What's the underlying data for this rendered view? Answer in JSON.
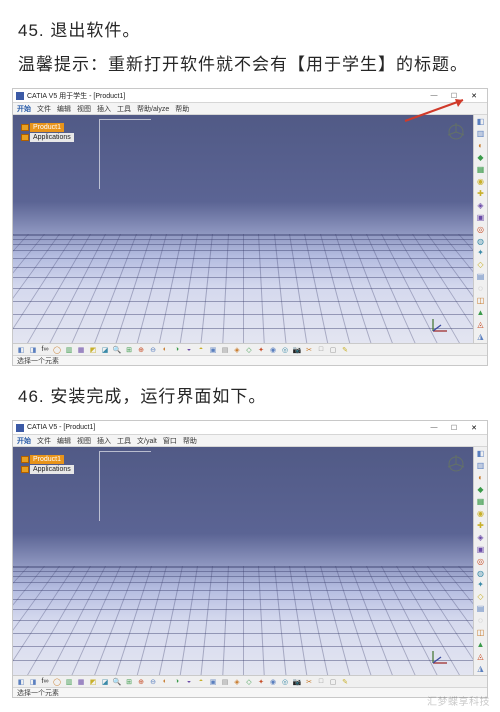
{
  "steps": {
    "s45_label": "45. 退出软件。",
    "s45_tip": "温馨提示：重新打开软件就不会有【用于学生】的标题。",
    "s46_label": "46. 安装完成，运行界面如下。"
  },
  "win1": {
    "title": "CATIA V5 用于学生 - [Product1]",
    "menus": [
      "开始",
      "文件",
      "编辑",
      "视图",
      "插入",
      "工具",
      "帮助/alyze",
      "帮助"
    ],
    "tree": {
      "product": "Product1",
      "applications": "Applications"
    },
    "status": "选择一个元素",
    "win_buttons": {
      "min": "—",
      "max": "☐",
      "close": "✕"
    }
  },
  "win2": {
    "title": "CATIA V5 - [Product1]",
    "menus": [
      "开始",
      "文件",
      "编辑",
      "视图",
      "插入",
      "工具",
      "文/yalt",
      "窗口",
      "帮助"
    ],
    "tree": {
      "product": "Product1",
      "applications": "Applications"
    },
    "status": "选择一个元素",
    "win_buttons": {
      "min": "—",
      "max": "☐",
      "close": "✕"
    }
  },
  "right_icons": [
    "◧",
    "▥",
    "◐",
    "◆",
    "▦",
    "◉",
    "✚",
    "◈",
    "▣",
    "◎",
    "◍",
    "✦",
    "◇",
    "▤",
    "◌",
    "◫",
    "▲",
    "◬",
    "◮"
  ],
  "bottom_icons": [
    "◧",
    "◨",
    "f∞",
    "◯",
    "▥",
    "▦",
    "◩",
    "◪",
    "🔍",
    "⊞",
    "⊕",
    "⊖",
    "◐",
    "◑",
    "◒",
    "◓",
    "▣",
    "▤",
    "◈",
    "◇",
    "✦",
    "◉",
    "◎",
    "📷",
    "✂",
    "□",
    "▢",
    "✎"
  ],
  "watermark": "汇梦蝶享科技"
}
